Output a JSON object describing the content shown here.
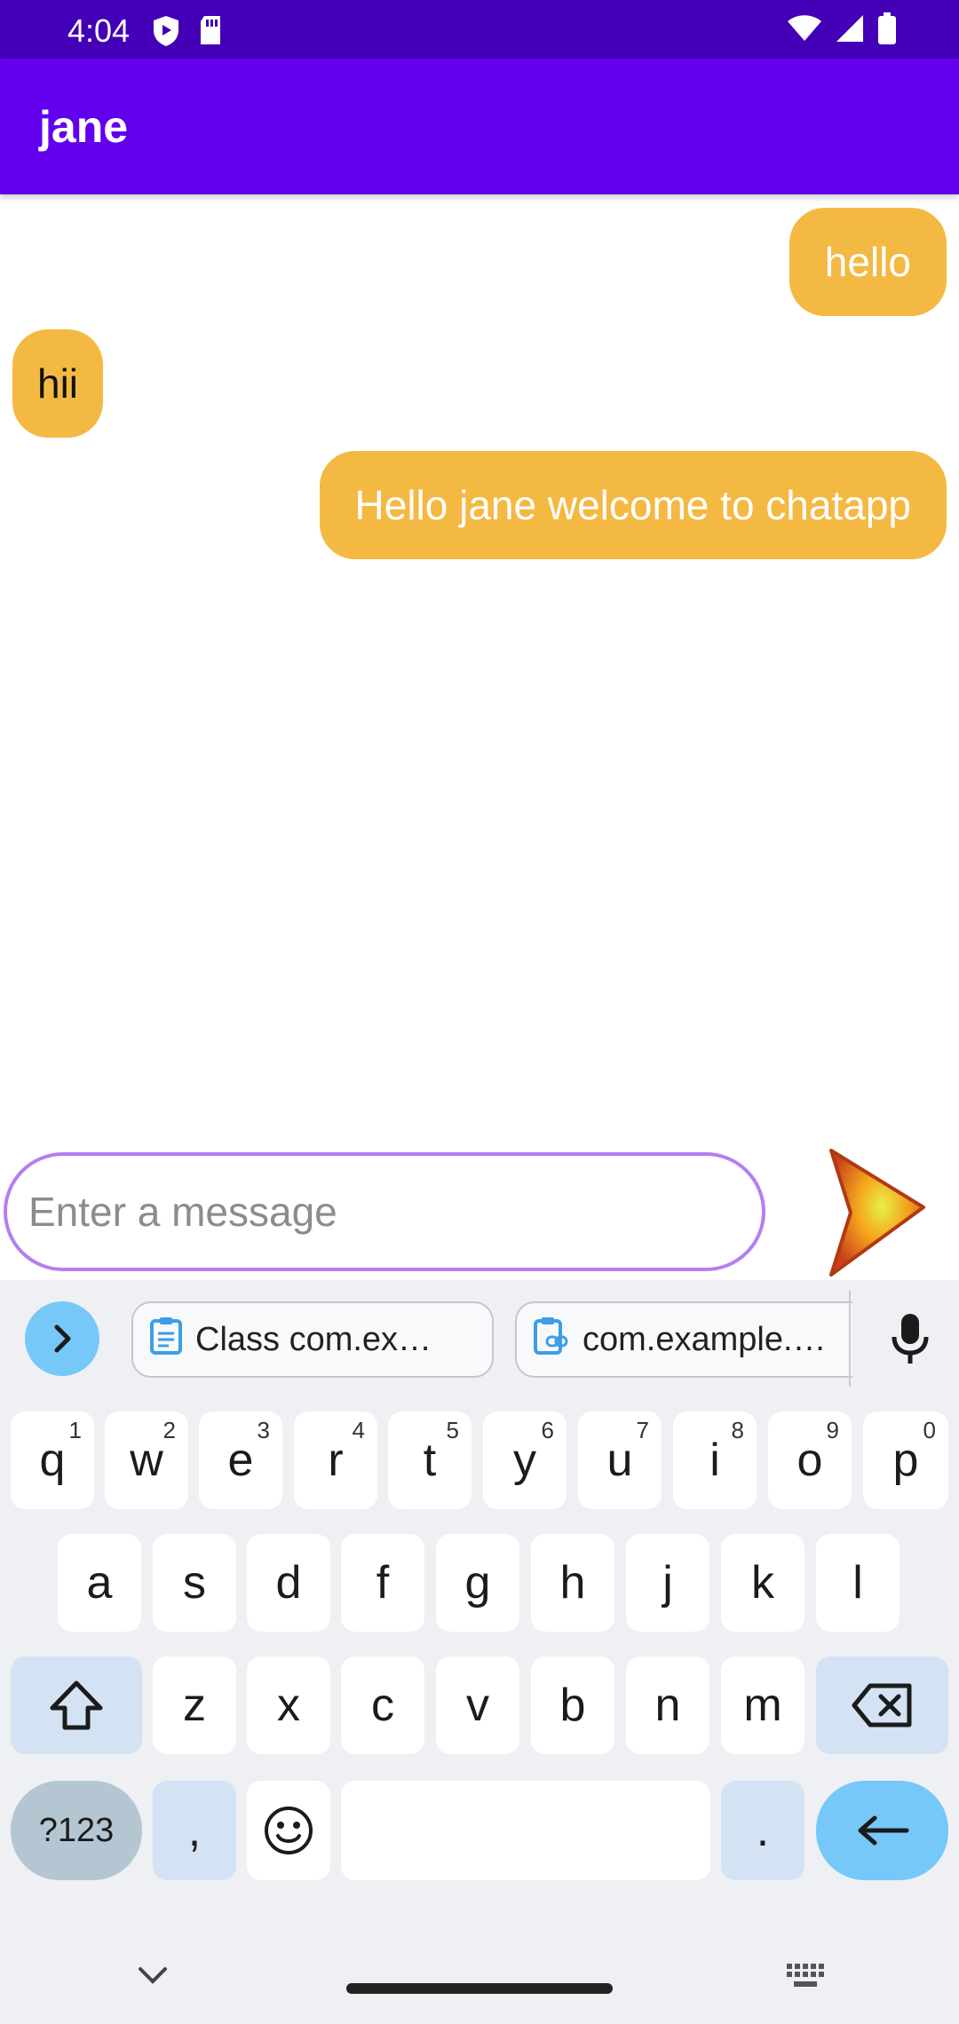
{
  "status_bar": {
    "time": "4:04"
  },
  "app_bar": {
    "title": "jane"
  },
  "messages": [
    {
      "text": "hello",
      "direction": "sent"
    },
    {
      "text": "hii",
      "direction": "received"
    },
    {
      "text": "Hello jane welcome to chatapp",
      "direction": "sent"
    }
  ],
  "composer": {
    "placeholder": "Enter a message",
    "value": ""
  },
  "keyboard": {
    "clipboard": [
      {
        "label": "Class com.ex…"
      },
      {
        "label": "com.example.…"
      }
    ],
    "row1": [
      {
        "key": "q",
        "hint": "1"
      },
      {
        "key": "w",
        "hint": "2"
      },
      {
        "key": "e",
        "hint": "3"
      },
      {
        "key": "r",
        "hint": "4"
      },
      {
        "key": "t",
        "hint": "5"
      },
      {
        "key": "y",
        "hint": "6"
      },
      {
        "key": "u",
        "hint": "7"
      },
      {
        "key": "i",
        "hint": "8"
      },
      {
        "key": "o",
        "hint": "9"
      },
      {
        "key": "p",
        "hint": "0"
      }
    ],
    "row2": [
      "a",
      "s",
      "d",
      "f",
      "g",
      "h",
      "j",
      "k",
      "l"
    ],
    "row3": [
      "z",
      "x",
      "c",
      "v",
      "b",
      "n",
      "m"
    ],
    "symbols_label": "?123",
    "comma": ",",
    "period": "."
  },
  "colors": {
    "status_bar": "#4300b6",
    "app_bar": "#6200ee",
    "bubble": "#f4b942",
    "input_border": "#b37ff0",
    "keyboard_accent": "#75c8f8"
  }
}
